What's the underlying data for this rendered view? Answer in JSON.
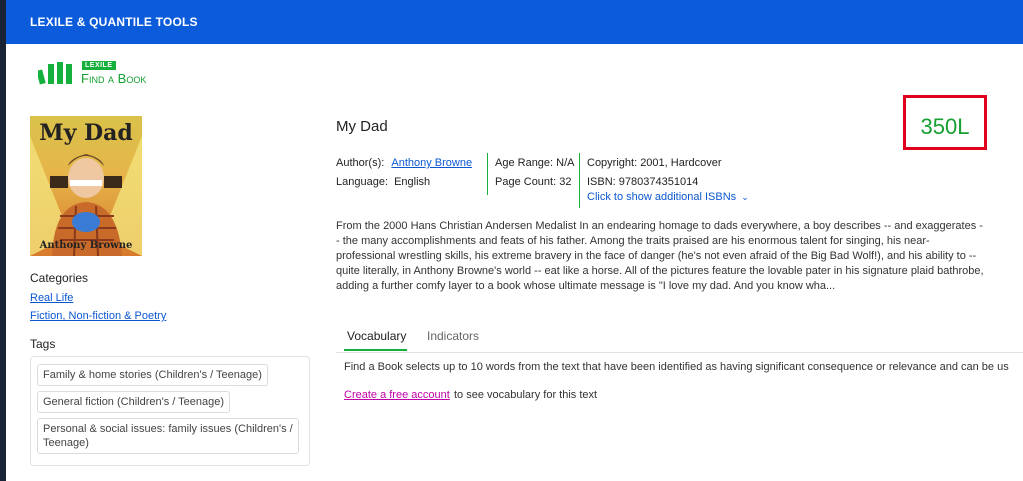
{
  "header": {
    "title": "LEXILE & QUANTILE TOOLS"
  },
  "logo": {
    "brand_small": "LEXILE",
    "brand_main": "Find a Book",
    "icon": "books-icon"
  },
  "book": {
    "cover_title": "My Dad",
    "cover_author": "Anthony Browne",
    "title": "My Dad",
    "lexile_measure": "350L",
    "author_label": "Author(s):",
    "author": "Anthony Browne",
    "language_label": "Language:",
    "language": "English",
    "age_range": "Age Range: N/A",
    "page_count": "Page Count: 32",
    "copyright": "Copyright: 2001, Hardcover",
    "isbn": "ISBN: 9780374351014",
    "additional_isbns": "Click to show additional ISBNs",
    "description": "From the 2000 Hans Christian Andersen Medalist In an endearing homage to dads everywhere, a boy describes -- and exaggerates -- the many accomplishments and feats of his father. Among the traits praised are his enormous talent for singing, his near-professional wrestling skills, his extreme bravery in the face of danger (he's not even afraid of the Big Bad Wolf!), and his ability to -- quite literally, in Anthony Browne's world -- eat like a horse. All of the pictures feature the lovable pater in his signature plaid bathrobe, adding a further comfy layer to a book whose ultimate message is \"I love my dad. And you know wha..."
  },
  "categories": {
    "heading": "Categories",
    "items": [
      "Real Life",
      "Fiction, Non-fiction & Poetry"
    ]
  },
  "tags": {
    "heading": "Tags",
    "items": [
      "Family & home stories (Children's / Teenage)",
      "General fiction (Children's / Teenage)",
      "Personal & social issues: family issues (Children's / Teenage)"
    ]
  },
  "tabs": [
    "Vocabulary",
    "Indicators"
  ],
  "vocabulary": {
    "intro": "Find a Book selects up to 10 words from the text that have been identified as having significant consequence or relevance and can be us",
    "account_link": "Create a free account",
    "account_rest": "to see vocabulary for this text"
  },
  "colors": {
    "header": "#0b5bdb",
    "accent_green": "#16a032",
    "highlight_red": "#e0001b",
    "link": "#0b57d0",
    "account_link": "#c000a8"
  }
}
